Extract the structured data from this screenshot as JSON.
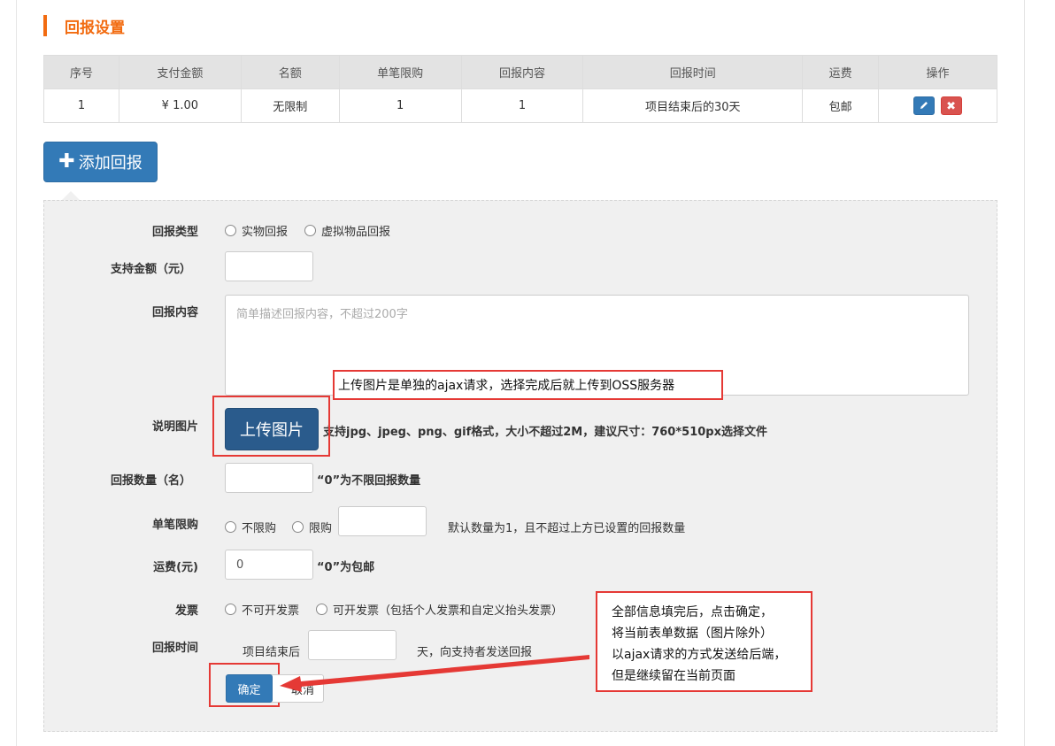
{
  "section": {
    "title": "回报设置"
  },
  "table": {
    "headers": [
      "序号",
      "支付金额",
      "名额",
      "单笔限购",
      "回报内容",
      "回报时间",
      "运费",
      "操作"
    ],
    "rows": [
      {
        "index": "1",
        "amount": "¥ 1.00",
        "quota": "无限制",
        "limit": "1",
        "content": "1",
        "time": "项目结束后的30天",
        "shipping": "包邮"
      }
    ],
    "edit_icon": "pencil-icon",
    "delete_icon": "close-icon"
  },
  "add_button": {
    "label": "添加回报",
    "icon": "plus-icon"
  },
  "form": {
    "reward_type": {
      "label": "回报类型",
      "options": [
        "实物回报",
        "虚拟物品回报"
      ]
    },
    "support_amount": {
      "label": "支持金额（元）",
      "value": ""
    },
    "reward_content": {
      "label": "回报内容",
      "placeholder": "简单描述回报内容，不超过200字"
    },
    "image": {
      "label": "说明图片",
      "button": "上传图片",
      "hint": "支持jpg、jpeg、png、gif格式，大小不超过2M，建议尺寸：760*510px选择文件"
    },
    "quantity": {
      "label": "回报数量（名）",
      "hint": "“0”为不限回报数量"
    },
    "single_limit": {
      "label": "单笔限购",
      "options": [
        "不限购",
        "限购"
      ],
      "hint": "默认数量为1，且不超过上方已设置的回报数量"
    },
    "shipping": {
      "label": "运费(元)",
      "value": "0",
      "hint": "“0”为包邮"
    },
    "invoice": {
      "label": "发票",
      "options": [
        "不可开发票",
        "可开发票（包括个人发票和自定义抬头发票）"
      ]
    },
    "reward_time": {
      "label": "回报时间",
      "prefix": "项目结束后",
      "suffix": "天，向支持者发送回报"
    },
    "confirm": "确定",
    "cancel": "取消"
  },
  "annotations": {
    "upload_note": "上传图片是单独的ajax请求，选择完成后就上传到OSS服务器",
    "submit_note": [
      "全部信息填完后，点击确定，",
      "将当前表单数据（图片除外）",
      "以ajax请求的方式发送给后端，",
      "但是继续留在当前页面"
    ]
  },
  "colors": {
    "accent": "#f26b10",
    "primary": "#337ab7",
    "danger": "#d9534f",
    "annotation": "#e53935"
  }
}
